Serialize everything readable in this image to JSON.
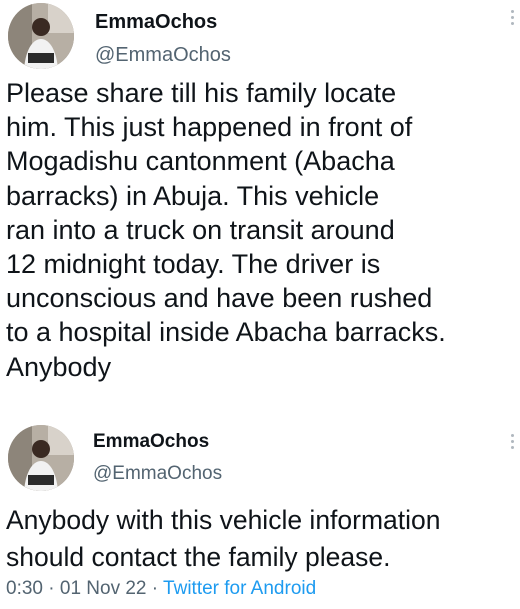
{
  "tweets": [
    {
      "display_name": "EmmaOchos",
      "handle": "@EmmaOchos",
      "text": "Please share till his family locate\nhim. This just happened in front of\nMogadishu cantonment (Abacha\nbarracks) in Abuja. This vehicle\nran into a truck on transit around\n12 midnight today. The driver is\nunconscious and have been rushed\nto a hospital inside Abacha barracks.\nAnybody"
    },
    {
      "display_name": "EmmaOchos",
      "handle": "@EmmaOchos",
      "text": "Anybody with this vehicle information\nshould contact the family please."
    }
  ],
  "meta": {
    "time": "0:30",
    "separator": "·",
    "date": "01 Nov 22",
    "source": "Twitter for Android"
  },
  "icons": {
    "more": "more-options-icon",
    "avatar": "avatar"
  },
  "colors": {
    "text": "#0f1419",
    "secondary": "#536471",
    "link": "#1d9bf0"
  }
}
